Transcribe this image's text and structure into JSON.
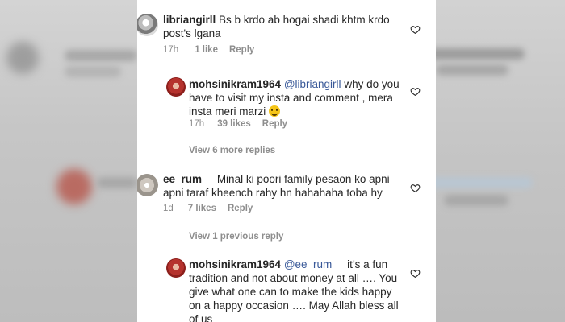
{
  "comments": [
    {
      "username": "libriangirll",
      "text": "Bs b krdo ab hogai shadi khtm krdo post's lgana",
      "time": "17h",
      "likes": "1 like",
      "reply": "Reply"
    },
    {
      "username": "mohsinikram1964",
      "mention": "@libriangirll",
      "text": "why do you have to visit my insta and comment , mera insta meri marzi",
      "time": "17h",
      "likes": "39 likes",
      "reply": "Reply"
    },
    {
      "username": "ee_rum__",
      "text": "Minal ki poori family pesaon ko apni apni taraf kheench rahy hn hahahaha toba hy",
      "time": "1d",
      "likes": "7 likes",
      "reply": "Reply"
    },
    {
      "username": "mohsinikram1964",
      "mention": "@ee_rum__",
      "text": "it’s a fun tradition and not about money at all …. You give what one can to make the kids happy on a happy occasion …. May Allah bless all of us"
    }
  ],
  "view_more_replies": "View 6 more replies",
  "view_previous_reply": "View 1 previous reply",
  "icons": {
    "like": "heart-outline-icon",
    "emoji": "grinning-face-emoji"
  },
  "colors": {
    "text": "#262626",
    "meta": "#8e8e8e",
    "background": "#ffffff"
  }
}
